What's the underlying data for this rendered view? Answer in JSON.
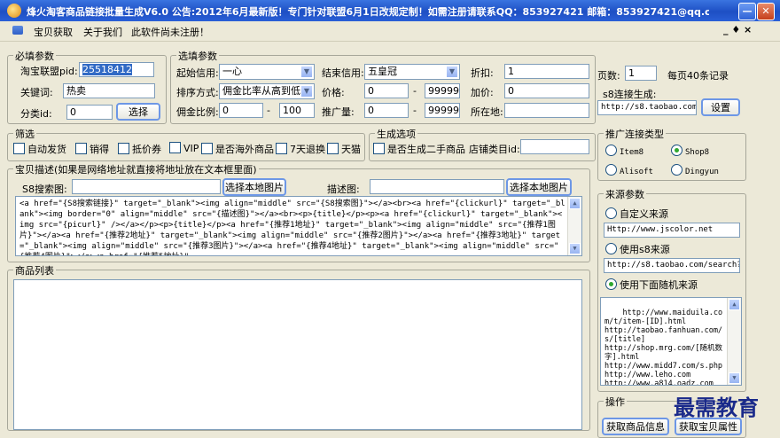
{
  "window": {
    "title": "烽火淘客商品链接批量生成V6.0 公告:2012年6月最新版！专门针对联盟6月1日改规定制！如需注册请联系QQ：853927421 邮箱：853927421@qq.com - [宝贝获取]",
    "min": "—",
    "close": "✕"
  },
  "menu": {
    "items": [
      "宝贝获取",
      "关于我们",
      "此软件尚未注册！"
    ],
    "right_controls": "_ ♦ ×"
  },
  "required": {
    "legend": "必填参数",
    "pid_label": "淘宝联盟pid:",
    "pid_value": "25518412",
    "keyword_label": "关键词:",
    "keyword_value": "热卖",
    "category_label": "分类id:",
    "category_value": "0",
    "select_btn": "选择"
  },
  "options": {
    "legend": "选填参数",
    "start_credit_label": "起始信用:",
    "start_credit_value": "一心",
    "end_credit_label": "结束信用:",
    "end_credit_value": "五皇冠",
    "discount_label": "折扣:",
    "discount_value": "1",
    "pages_label": "页数:",
    "pages_value": "1",
    "per_page_text": "每页40条记录",
    "sort_label": "排序方式:",
    "sort_value": "佣金比率从高到低",
    "price_label": "价格:",
    "price_min": "0",
    "price_max": "99999",
    "markup_label": "加价:",
    "markup_value": "0",
    "s8_label": "s8连接生成:",
    "commission_label": "佣金比例:",
    "commission_min": "0",
    "commission_max": "100",
    "promo_label": "推广量:",
    "promo_min": "0",
    "promo_max": "99999",
    "location_label": "所在地:",
    "location_value": "",
    "s8_value": "http://s8.taobao.com/s",
    "settings_btn": "设置",
    "dash": "-"
  },
  "filter": {
    "legend": "筛选",
    "items": [
      "自动发货",
      "销得",
      "抵价券",
      "VIP",
      "是否海外商品",
      "7天退换",
      "天猫"
    ]
  },
  "generate": {
    "legend": "生成选项",
    "secondhand": "是否生成二手商品",
    "store_cat_label": "店铺类目id:",
    "store_cat_value": ""
  },
  "desc": {
    "legend": "宝贝描述(如果是网络地址就直接将地址放在文本框里面)",
    "s8_img_label": "S8搜索图:",
    "s8_img_value": "",
    "choose_local_1": "选择本地图片",
    "desc_img_label": "描述图:",
    "desc_img_value": "",
    "choose_local_2": "选择本地图片",
    "template": "<a href=\"{S8搜索链接}\" target=\"_blank\"><img align=\"middle\" src=\"{S8搜索图}\"></a><br><a href=\"{clickurl}\" target=\"_blank\"><img border=\"0\" align=\"middle\" src=\"{描述图}\"></a><br><p>{title}</p><p><a href=\"{clickurl}\" target=\"_blank\"><img src=\"{picurl}\" /></a></p><p>{title}</p><a href=\"{推荐1地址}\" target=\"_blank\"><img align=\"middle\" src=\"{推荐1图片}\"></a><a href=\"{推荐2地址}\" target=\"_blank\"><img align=\"middle\" src=\"{推荐2图片}\"></a><a href=\"{推荐3地址}\" target=\"_blank\"><img align=\"middle\" src=\"{推荐3图片}\"></a><a href=\"{推荐4地址}\" target=\"_blank\"><img align=\"middle\" src=\"{推荐4图片}\"></a><a href=\"{推荐5地址}\""
  },
  "products": {
    "legend": "商品列表"
  },
  "promo_type": {
    "legend": "推广连接类型",
    "items": [
      "Item8",
      "Shop8",
      "Alisoft",
      "Dingyun"
    ],
    "selected": "Shop8"
  },
  "source": {
    "legend": "来源参数",
    "custom_label": "自定义来源",
    "custom_value": "Http://www.jscolor.net",
    "s8_label": "使用s8来源",
    "s8_value": "http://s8.taobao.com/search?q=",
    "random_label": "使用下面随机来源",
    "random_list": "http://www.maiduila.com/t/item-[ID].html\nhttp://taobao.fanhuan.com/s/[title]\nhttp://shop.mrg.com/[随机数字].html\nhttp://www.midd7.com/s.php\nhttp://www.leho.com\nhttp://www.a814.oadz.com\nhttp://www.m18.com"
  },
  "actions": {
    "legend": "操作",
    "get_product_btn": "获取商品信息",
    "get_attr_btn": "获取宝贝属性"
  },
  "watermark": "最需教育"
}
